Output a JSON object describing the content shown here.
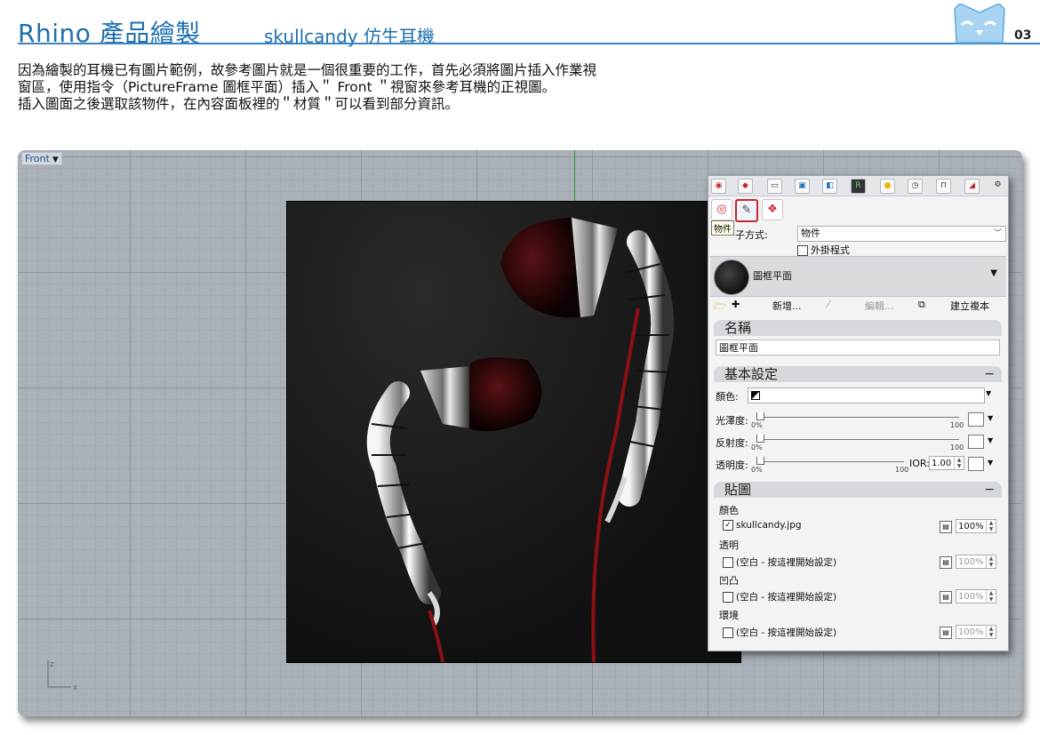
{
  "header": {
    "title": "Rhino 產品繪製",
    "subtitle": "skullcandy 仿生耳機",
    "page_number": "03"
  },
  "intro": {
    "line1": "因為繪製的耳機已有圖片範例，故參考圖片就是一個很重要的工作，首先必須將圖片插入作業視",
    "line2": "窗區，使用指令（PictureFrame 圖框平面）插入＂ Front ＂視窗來參考耳機的正視圖。",
    "line3": "插入圖面之後選取該物件，在內容面板裡的＂材質＂可以看到部分資訊。"
  },
  "viewport": {
    "name": "Front",
    "axis_z": "z",
    "axis_x": "x"
  },
  "panel": {
    "tooltip": "物件",
    "assign_label": "子方式:",
    "assign_value": "物件",
    "plugin_label": "外掛程式",
    "material_name": "圖框平面",
    "new_label": "新增...",
    "edit_label": "編輯...",
    "duplicate_label": "建立複本",
    "sections": {
      "name": "名稱",
      "basic": "基本設定",
      "maps": "貼圖"
    },
    "name_value": "圖框平面",
    "color_label": "顏色:",
    "gloss_label": "光澤度:",
    "reflect_label": "反射度:",
    "transp_label": "透明度:",
    "zero_pct": "0%",
    "hundred": "100",
    "ior_label": "IOR:",
    "ior_value": "1.00",
    "map_color_label": "顏色",
    "map_color_file": "skullcandy.jpg",
    "map_color_pct": "100%",
    "map_transp_label": "透明",
    "map_bump_label": "凹凸",
    "map_env_label": "環境",
    "empty_text": "(空白 - 按這裡開始設定)",
    "pct_100": "100%"
  },
  "colors": {
    "accent_blue": "#1d6fae",
    "selection_red": "#c9262d"
  }
}
